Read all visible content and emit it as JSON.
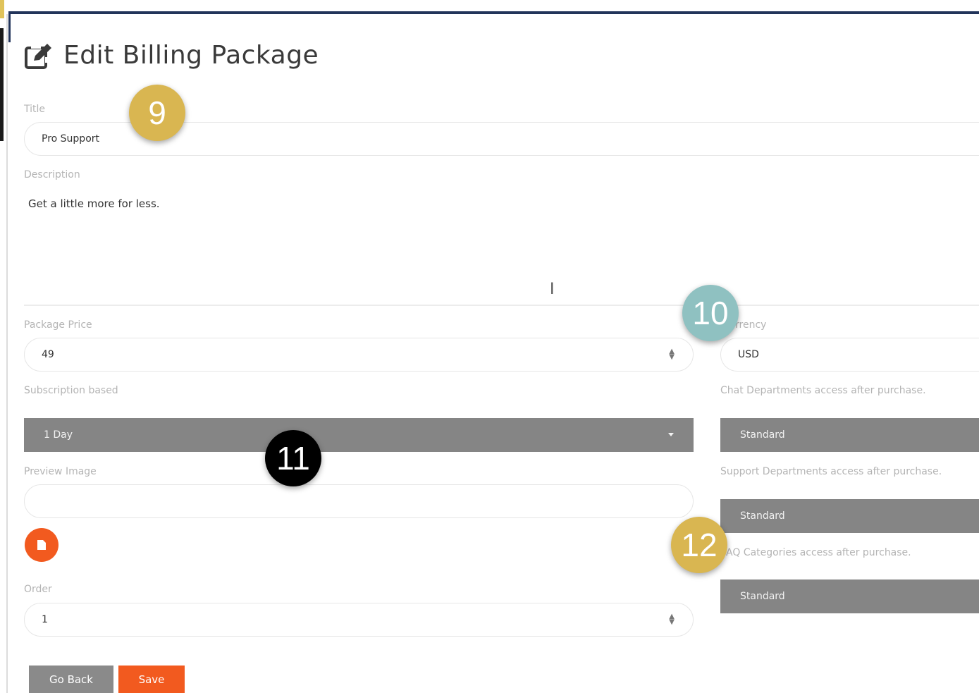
{
  "header": {
    "title": "Edit Billing Package"
  },
  "form": {
    "title_label": "Title",
    "title_value": "Pro Support",
    "description_label": "Description",
    "description_value": "Get a little more for less.",
    "price_label": "Package Price",
    "price_value": "49",
    "currency_label_visible": "rrency",
    "currency_value": "USD",
    "subscription_label": "Subscription based",
    "subscription_value": "1 Day",
    "chat_label": "Chat Departments access after purchase.",
    "chat_value": "Standard",
    "support_label": "Support Departments access after purchase.",
    "support_value": "Standard",
    "faq_label_visible": "AQ Categories access after purchase.",
    "faq_value": "Standard",
    "preview_label": "Preview Image",
    "preview_value": "",
    "order_label": "Order",
    "order_value": "1"
  },
  "buttons": {
    "back": "Go Back",
    "save": "Save"
  },
  "badges": [
    {
      "text": "9",
      "color": "#d9b651",
      "text_color": "#ffffff"
    },
    {
      "text": "10",
      "color": "#8fc1c1",
      "text_color": "#ffffff"
    },
    {
      "text": "11",
      "color": "#000000",
      "text_color": "#ffffff"
    },
    {
      "text": "12",
      "color": "#d9b651",
      "text_color": "#ffffff"
    }
  ],
  "colors": {
    "accent": "#f25a1f",
    "select_bg": "#858585",
    "header_border": "#22345a"
  },
  "icons": {
    "edit": "edit-icon",
    "file": "file-icon",
    "caret": "caret-down-icon",
    "stepper": "stepper-icon",
    "cursor": "text-cursor-icon"
  }
}
